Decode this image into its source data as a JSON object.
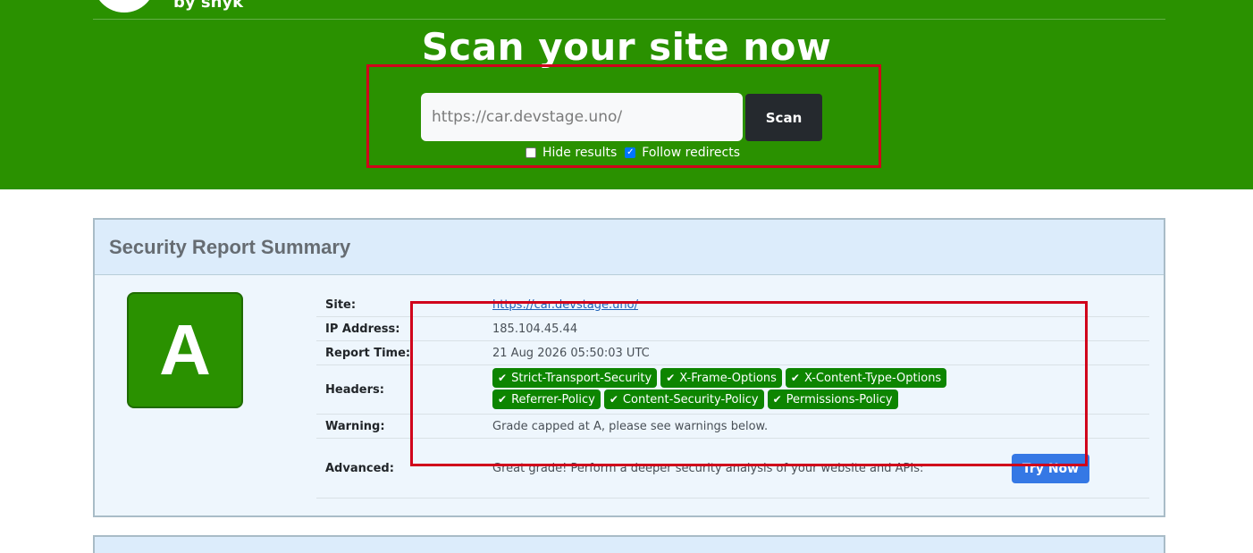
{
  "brand": {
    "by_text": "by snyk"
  },
  "hero": {
    "title": "Scan your site now"
  },
  "scan": {
    "placeholder": "https://car.devstage.uno/",
    "button_label": "Scan",
    "hide_results_label": "Hide results",
    "hide_results_checked": false,
    "follow_redirects_label": "Follow redirects",
    "follow_redirects_checked": true
  },
  "report": {
    "title": "Security Report Summary",
    "grade": "A",
    "grade_color": "#2a9100",
    "rows": {
      "site": {
        "label": "Site:",
        "value": "https://car.devstage.uno/"
      },
      "ip": {
        "label": "IP Address:",
        "value": "185.104.45.44"
      },
      "time": {
        "label": "Report Time:",
        "value": "21 Aug 2026 05:50:03 UTC"
      },
      "headers": {
        "label": "Headers:",
        "badges": [
          "Strict-Transport-Security",
          "X-Frame-Options",
          "X-Content-Type-Options",
          "Referrer-Policy",
          "Content-Security-Policy",
          "Permissions-Policy"
        ]
      },
      "warning": {
        "label": "Warning:",
        "value": "Grade capped at A, please see warnings below."
      },
      "advanced": {
        "label": "Advanced:",
        "value": "Great grade! Perform a deeper security analysis of your website and APIs:",
        "button_label": "Try Now"
      }
    }
  },
  "colors": {
    "hero_green": "#2a9100",
    "badge_green": "#0d8500",
    "annotation_red": "#d0021b",
    "try_blue": "#3578e5"
  }
}
